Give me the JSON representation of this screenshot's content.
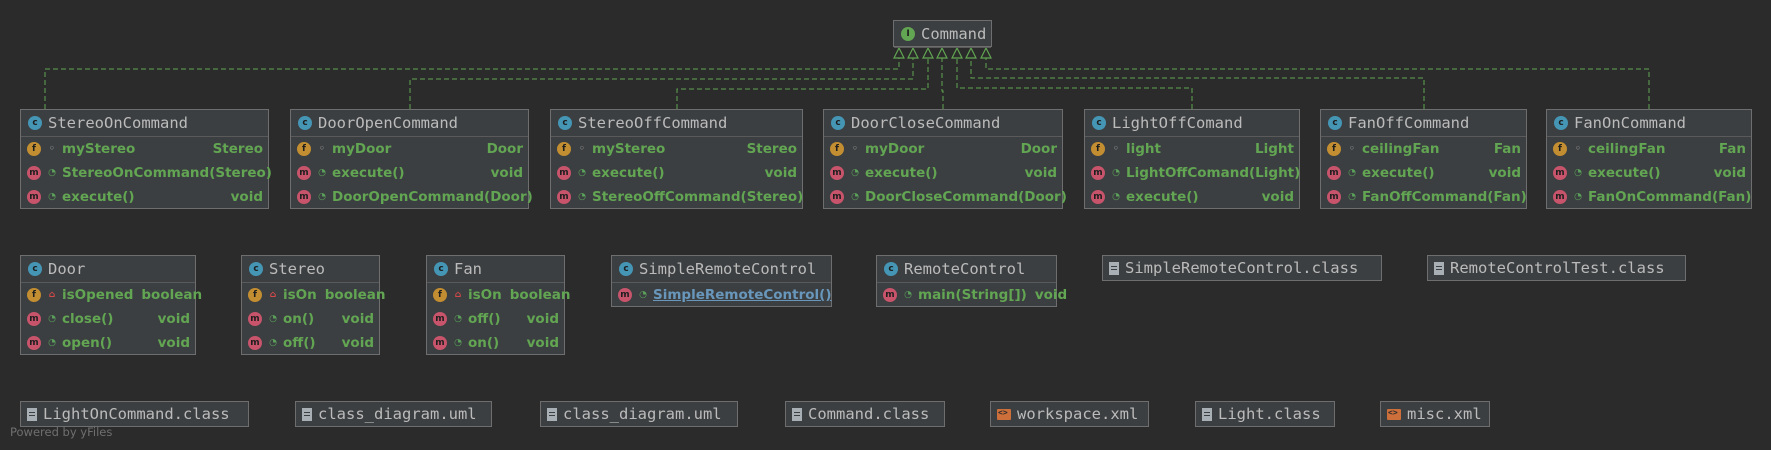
{
  "colors": {
    "background": "#2b2b2b",
    "node": "#3c3f41",
    "member_text": "#62a552",
    "edge": "#62a552"
  },
  "interface": {
    "name": "Command",
    "icon": "interface-icon"
  },
  "implementors": [
    {
      "name": "StereoOnCommand",
      "rows": [
        {
          "kind": "f",
          "vis": "pkg",
          "name": "myStereo",
          "type": "Stereo"
        },
        {
          "kind": "m",
          "vis": "pub",
          "name": "StereoOnCommand(Stereo)",
          "type": ""
        },
        {
          "kind": "m",
          "vis": "pub",
          "name": "execute()",
          "type": "void"
        }
      ]
    },
    {
      "name": "DoorOpenCommand",
      "rows": [
        {
          "kind": "f",
          "vis": "pkg",
          "name": "myDoor",
          "type": "Door"
        },
        {
          "kind": "m",
          "vis": "pub",
          "name": "execute()",
          "type": "void"
        },
        {
          "kind": "m",
          "vis": "pub",
          "name": "DoorOpenCommand(Door)",
          "type": ""
        }
      ]
    },
    {
      "name": "StereoOffCommand",
      "rows": [
        {
          "kind": "f",
          "vis": "pkg",
          "name": "myStereo",
          "type": "Stereo"
        },
        {
          "kind": "m",
          "vis": "pub",
          "name": "execute()",
          "type": "void"
        },
        {
          "kind": "m",
          "vis": "pub",
          "name": "StereoOffCommand(Stereo)",
          "type": ""
        }
      ]
    },
    {
      "name": "DoorCloseCommand",
      "rows": [
        {
          "kind": "f",
          "vis": "pkg",
          "name": "myDoor",
          "type": "Door"
        },
        {
          "kind": "m",
          "vis": "pub",
          "name": "execute()",
          "type": "void"
        },
        {
          "kind": "m",
          "vis": "pub",
          "name": "DoorCloseCommand(Door)",
          "type": ""
        }
      ]
    },
    {
      "name": "LightOffComand",
      "rows": [
        {
          "kind": "f",
          "vis": "pkg",
          "name": "light",
          "type": "Light"
        },
        {
          "kind": "m",
          "vis": "pub",
          "name": "LightOffComand(Light)",
          "type": ""
        },
        {
          "kind": "m",
          "vis": "pub",
          "name": "execute()",
          "type": "void"
        }
      ]
    },
    {
      "name": "FanOffCommand",
      "rows": [
        {
          "kind": "f",
          "vis": "pkg",
          "name": "ceilingFan",
          "type": "Fan"
        },
        {
          "kind": "m",
          "vis": "pub",
          "name": "execute()",
          "type": "void"
        },
        {
          "kind": "m",
          "vis": "pub",
          "name": "FanOffCommand(Fan)",
          "type": ""
        }
      ]
    },
    {
      "name": "FanOnCommand",
      "rows": [
        {
          "kind": "f",
          "vis": "pkg",
          "name": "ceilingFan",
          "type": "Fan"
        },
        {
          "kind": "m",
          "vis": "pub",
          "name": "execute()",
          "type": "void"
        },
        {
          "kind": "m",
          "vis": "pub",
          "name": "FanOnCommand(Fan)",
          "type": ""
        }
      ]
    }
  ],
  "receivers": [
    {
      "name": "Door",
      "rows": [
        {
          "kind": "f",
          "vis": "priv",
          "name": "isOpened",
          "type": "boolean"
        },
        {
          "kind": "m",
          "vis": "pub",
          "name": "close()",
          "type": "void"
        },
        {
          "kind": "m",
          "vis": "pub",
          "name": "open()",
          "type": "void"
        }
      ]
    },
    {
      "name": "Stereo",
      "rows": [
        {
          "kind": "f",
          "vis": "priv",
          "name": "isOn",
          "type": "boolean"
        },
        {
          "kind": "m",
          "vis": "pub",
          "name": "on()",
          "type": "void"
        },
        {
          "kind": "m",
          "vis": "pub",
          "name": "off()",
          "type": "void"
        }
      ]
    },
    {
      "name": "Fan",
      "rows": [
        {
          "kind": "f",
          "vis": "priv",
          "name": "isOn",
          "type": "boolean"
        },
        {
          "kind": "m",
          "vis": "pub",
          "name": "off()",
          "type": "void"
        },
        {
          "kind": "m",
          "vis": "pub",
          "name": "on()",
          "type": "void"
        }
      ]
    },
    {
      "name": "SimpleRemoteControl",
      "rows": [
        {
          "kind": "m",
          "vis": "pub",
          "name": "SimpleRemoteControl()",
          "type": "",
          "static": true
        }
      ]
    },
    {
      "name": "RemoteControl",
      "rows": [
        {
          "kind": "m",
          "vis": "pub",
          "name": "main(String[])",
          "type": "void"
        }
      ]
    }
  ],
  "row2_files": [
    {
      "name": "SimpleRemoteControl.class",
      "icon": "class-file-icon"
    },
    {
      "name": "RemoteControlTest.class",
      "icon": "class-file-icon"
    }
  ],
  "row3_files": [
    {
      "name": "LightOnCommand.class",
      "icon": "class-file-icon"
    },
    {
      "name": "class_diagram.uml",
      "icon": "uml-file-icon"
    },
    {
      "name": "class_diagram.uml",
      "icon": "uml-file-icon"
    },
    {
      "name": "Command.class",
      "icon": "class-file-icon"
    },
    {
      "name": "workspace.xml",
      "icon": "xml-file-icon"
    },
    {
      "name": "Light.class",
      "icon": "class-file-icon"
    },
    {
      "name": "misc.xml",
      "icon": "xml-file-icon"
    }
  ],
  "footer": {
    "powered": "Powered by yFiles"
  }
}
